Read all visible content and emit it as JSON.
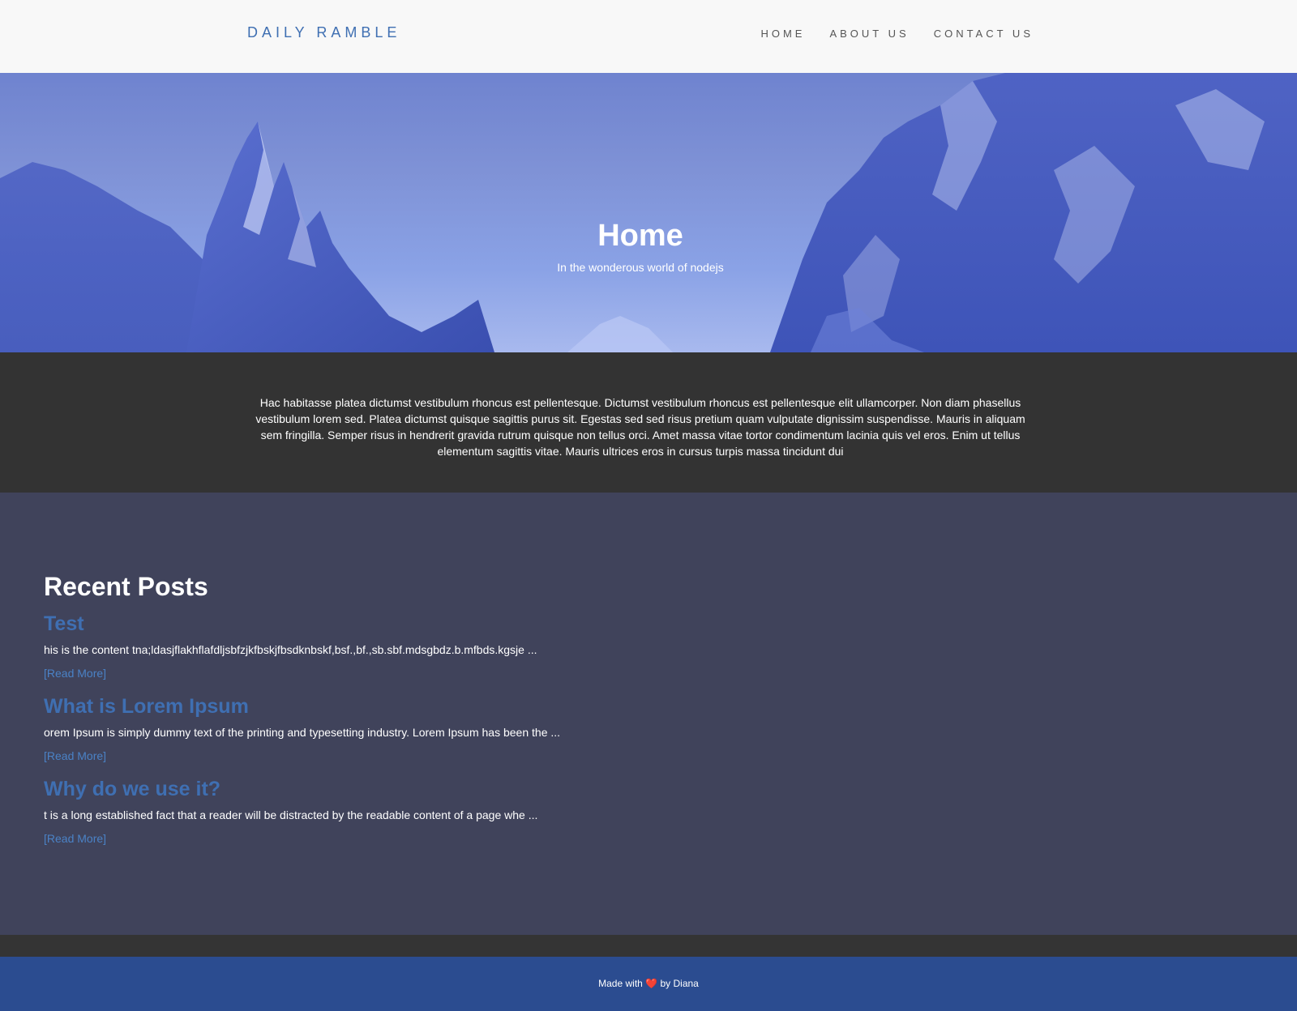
{
  "header": {
    "brand": "DAILY RAMBLE",
    "nav": [
      "HOME",
      "ABOUT US",
      "CONTACT US"
    ]
  },
  "hero": {
    "title": "Home",
    "subtitle": "In the wonderous world of nodejs"
  },
  "intro": {
    "text": "Hac habitasse platea dictumst vestibulum rhoncus est pellentesque. Dictumst vestibulum rhoncus est pellentesque elit ullamcorper. Non diam phasellus vestibulum lorem sed. Platea dictumst quisque sagittis purus sit. Egestas sed sed risus pretium quam vulputate dignissim suspendisse. Mauris in aliquam sem fringilla. Semper risus in hendrerit gravida rutrum quisque non tellus orci. Amet massa vitae tortor condimentum lacinia quis vel eros. Enim ut tellus elementum sagittis vitae. Mauris ultrices eros in cursus turpis massa tincidunt dui"
  },
  "posts": {
    "heading": "Recent Posts",
    "read_more": "[Read More]",
    "items": [
      {
        "title": "Test",
        "excerpt": "his is the content tna;ldasjflakhflafdljsbfzjkfbskjfbsdknbskf,bsf.,bf.,sb.sbf.mdsgbdz.b.mfbds.kgsje ..."
      },
      {
        "title": "What is Lorem Ipsum",
        "excerpt": "orem Ipsum is simply dummy text of the printing and typesetting industry. Lorem Ipsum has been the ..."
      },
      {
        "title": "Why do we use it?",
        "excerpt": "t is a long established fact that a reader will be distracted by the readable content of a page whe ..."
      }
    ]
  },
  "footer": {
    "prefix": "Made with",
    "heart": "❤️",
    "suffix": "by Diana"
  },
  "colors": {
    "accent": "#3f6fb2",
    "posts_bg": "#40435b",
    "footer_bg": "#2b4c90",
    "dark_bg": "#333333"
  }
}
